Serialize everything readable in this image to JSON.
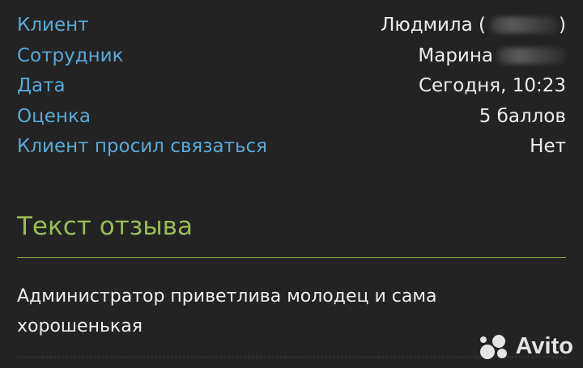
{
  "fields": [
    {
      "label": "Клиент",
      "value": "Людмила (",
      "suffix": ")",
      "redacted": true
    },
    {
      "label": "Сотрудник",
      "value": "Марина",
      "suffix": "",
      "redacted": true
    },
    {
      "label": "Дата",
      "value": "Сегодня, 10:23",
      "suffix": "",
      "redacted": false
    },
    {
      "label": "Оценка",
      "value": "5 баллов",
      "suffix": "",
      "redacted": false
    },
    {
      "label": "Клиент просил связаться",
      "value": "Нет",
      "suffix": "",
      "redacted": false
    }
  ],
  "review": {
    "title": "Текст отзыва",
    "text": "Администратор приветлива молодец и сама хорошенькая"
  },
  "watermark": {
    "text": "Avito",
    "icon": "avito-logo-icon"
  },
  "colors": {
    "background": "#232323",
    "label": "#5aa9d6",
    "value": "#eeeeee",
    "title": "#9bbd52",
    "divider": "#8aa84a"
  }
}
